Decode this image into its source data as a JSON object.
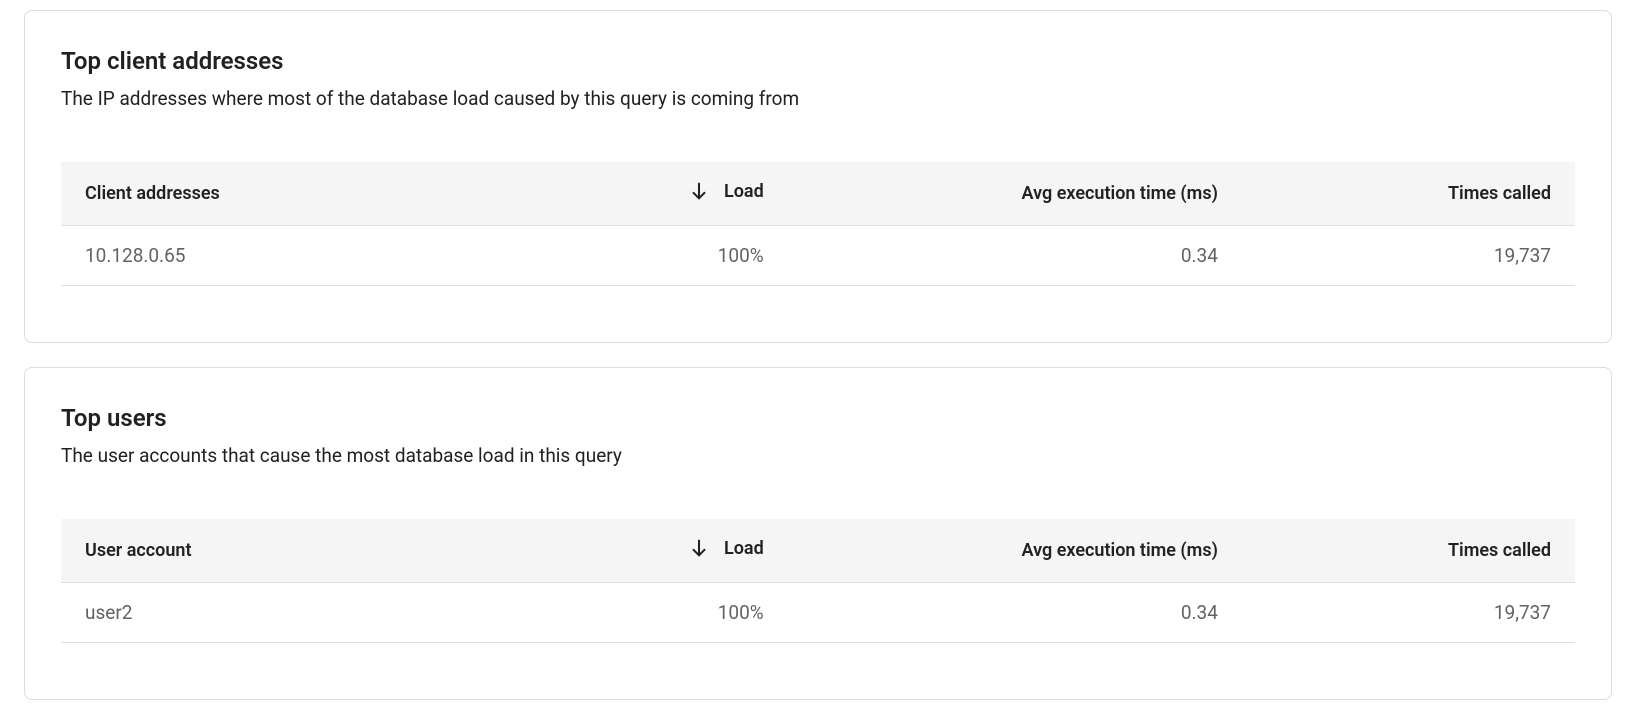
{
  "cards": [
    {
      "title": "Top client addresses",
      "desc": "The IP addresses where most of the database load caused by this query is coming from",
      "columns": {
        "first": "Client addresses",
        "load": "Load",
        "avg": "Avg execution time (ms)",
        "times": "Times called"
      },
      "row": {
        "first": "10.128.0.65",
        "load": "100%",
        "avg": "0.34",
        "times": "19,737"
      }
    },
    {
      "title": "Top users",
      "desc": "The user accounts that cause the most database load in this query",
      "columns": {
        "first": "User account",
        "load": "Load",
        "avg": "Avg execution time (ms)",
        "times": "Times called"
      },
      "row": {
        "first": "user2",
        "load": "100%",
        "avg": "0.34",
        "times": "19,737"
      }
    }
  ]
}
